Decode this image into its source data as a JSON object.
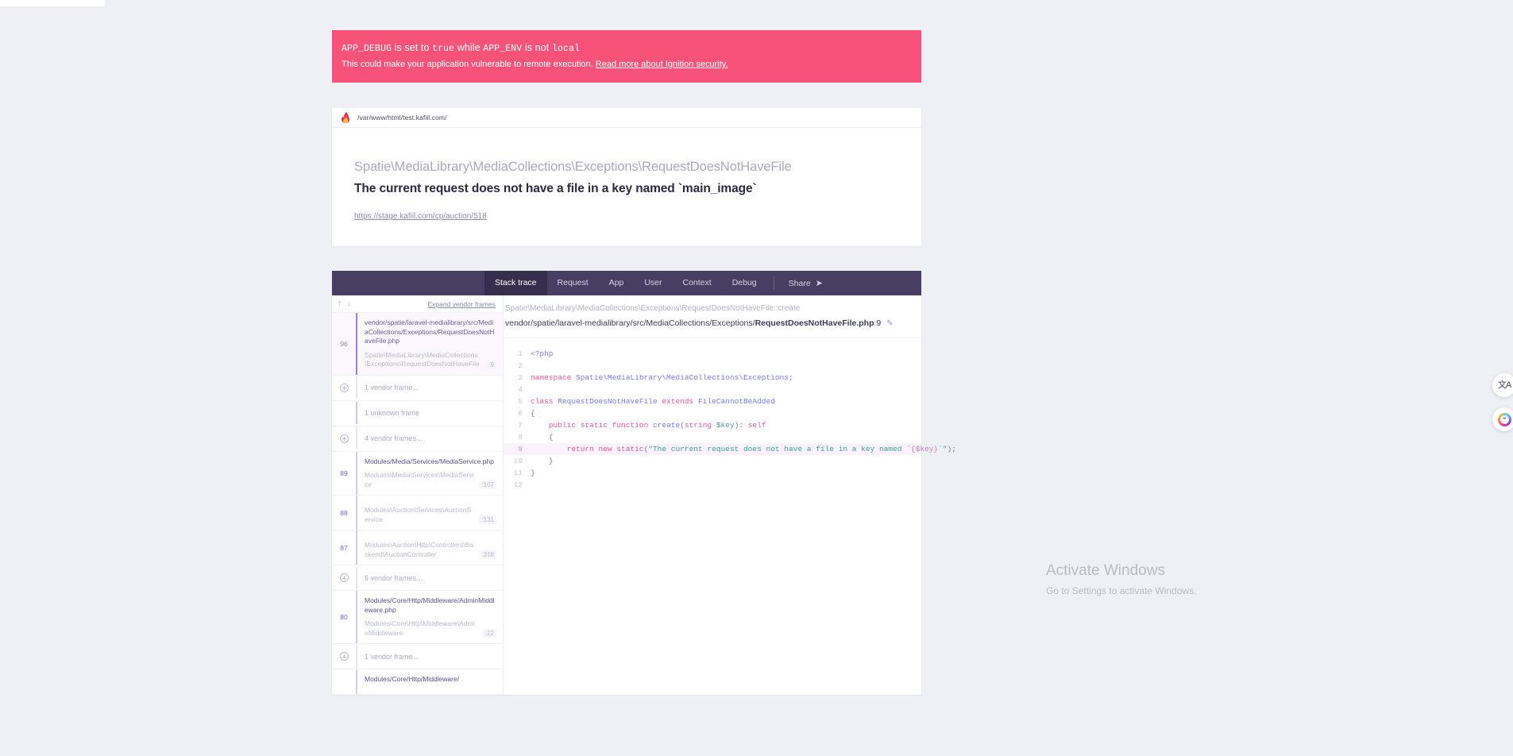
{
  "banner": {
    "title_pre": "APP_DEBUG",
    "title_mid1": " is set to ",
    "title_code1": "true",
    "title_mid2": " while ",
    "title_pre2": "APP_ENV",
    "title_mid3": " is not ",
    "title_code2": "local",
    "subtitle": "This could make your application vulnerable to remote execution.",
    "link_text": "Read more about Ignition security.",
    "bg_color": "#f6527a"
  },
  "exception": {
    "file_path": "/var/www/html/test.kafiil.com/",
    "class_name": "Spatie\\MediaLibrary\\MediaCollections\\Exceptions\\RequestDoesNotHaveFile",
    "message": "The current request does not have a file in a key named `main_image`",
    "request_url": "https://stage.kafiil.com/cp/auction/518"
  },
  "tabs": {
    "items": [
      {
        "label": "Stack trace",
        "active": true
      },
      {
        "label": "Request",
        "active": false
      },
      {
        "label": "App",
        "active": false
      },
      {
        "label": "User",
        "active": false
      },
      {
        "label": "Context",
        "active": false
      },
      {
        "label": "Debug",
        "active": false
      }
    ],
    "share_label": "Share",
    "share_icon": "share-arrow-icon"
  },
  "frames_toolbar": {
    "up_icon": "arrow-up-icon",
    "down_icon": "arrow-down-icon",
    "expand_vendor_label": "Expand vendor frames"
  },
  "frames": [
    {
      "kind": "frame",
      "selected": true,
      "number": "96",
      "file": "vendor/spatie/laravel-medialibrary/src/MediaCollections/Exceptions/RequestDoesNotHaveFile.php",
      "class": "Spatie\\MediaLibrary\\MediaCollections\\Exceptions\\RequestDoesNotHaveFile",
      "line": ":9"
    },
    {
      "kind": "collapsed",
      "has_plus": true,
      "label": "1 vendor frame…"
    },
    {
      "kind": "collapsed",
      "has_plus": false,
      "label": "1 unknown frame"
    },
    {
      "kind": "collapsed",
      "has_plus": true,
      "label": "4 vendor frames…"
    },
    {
      "kind": "frame",
      "selected": false,
      "number": "89",
      "file": "Modules/Media/Services/MediaService.php",
      "class": "Modules\\Media\\Services\\MediaService",
      "line": ":107"
    },
    {
      "kind": "frame",
      "selected": false,
      "number": "88",
      "file": "",
      "class": "Modules\\Auction\\Services\\AuctionService",
      "line": ":131"
    },
    {
      "kind": "frame",
      "selected": false,
      "number": "87",
      "file": "",
      "class": "Modules\\Auction\\Http\\Controllers\\Backend\\AuctionController",
      "line": ":318"
    },
    {
      "kind": "collapsed",
      "has_plus": true,
      "label": "6 vendor frames…"
    },
    {
      "kind": "frame",
      "selected": false,
      "number": "80",
      "file": "Modules/Core/Http/Middleware/AdminMiddleware.php",
      "class": "Modules\\Core\\Http\\Middleware\\AdminMiddleware",
      "line": ":22"
    },
    {
      "kind": "collapsed",
      "has_plus": true,
      "label": "1 vendor frame…"
    }
  ],
  "code_panel": {
    "signature": "Spatie\\MediaLibrary\\MediaCollections\\Exceptions\\RequestDoesNotHaveFile::create",
    "location_prefix": "vendor/spatie/laravel-medialibrary/src/MediaCollections/Exceptions/",
    "location_file": "RequestDoesNotHaveFile.php",
    "location_line": ":9",
    "edit_icon": "pencil-icon",
    "highlight_line": 9,
    "lines": [
      {
        "n": "1",
        "text": "<?php"
      },
      {
        "n": "2",
        "text": ""
      },
      {
        "n": "3",
        "text": "namespace Spatie\\MediaLibrary\\MediaCollections\\Exceptions;"
      },
      {
        "n": "4",
        "text": ""
      },
      {
        "n": "5",
        "text": "class RequestDoesNotHaveFile extends FileCannotBeAdded"
      },
      {
        "n": "6",
        "text": "{"
      },
      {
        "n": "7",
        "text": "    public static function create(string $key): self"
      },
      {
        "n": "8",
        "text": "    {"
      },
      {
        "n": "9",
        "text": "        return new static(\"The current request does not have a file in a key named `{$key}`\");"
      },
      {
        "n": "10",
        "text": "    }"
      },
      {
        "n": "11",
        "text": "}"
      },
      {
        "n": "12",
        "text": ""
      }
    ]
  },
  "float_widgets": [
    {
      "icon": "translate-icon",
      "glyph": "文A"
    },
    {
      "icon": "ai-assistant-icon",
      "glyph": "••"
    }
  ],
  "watermark": {
    "title": "Activate Windows",
    "subtitle": "Go to Settings to activate Windows."
  }
}
